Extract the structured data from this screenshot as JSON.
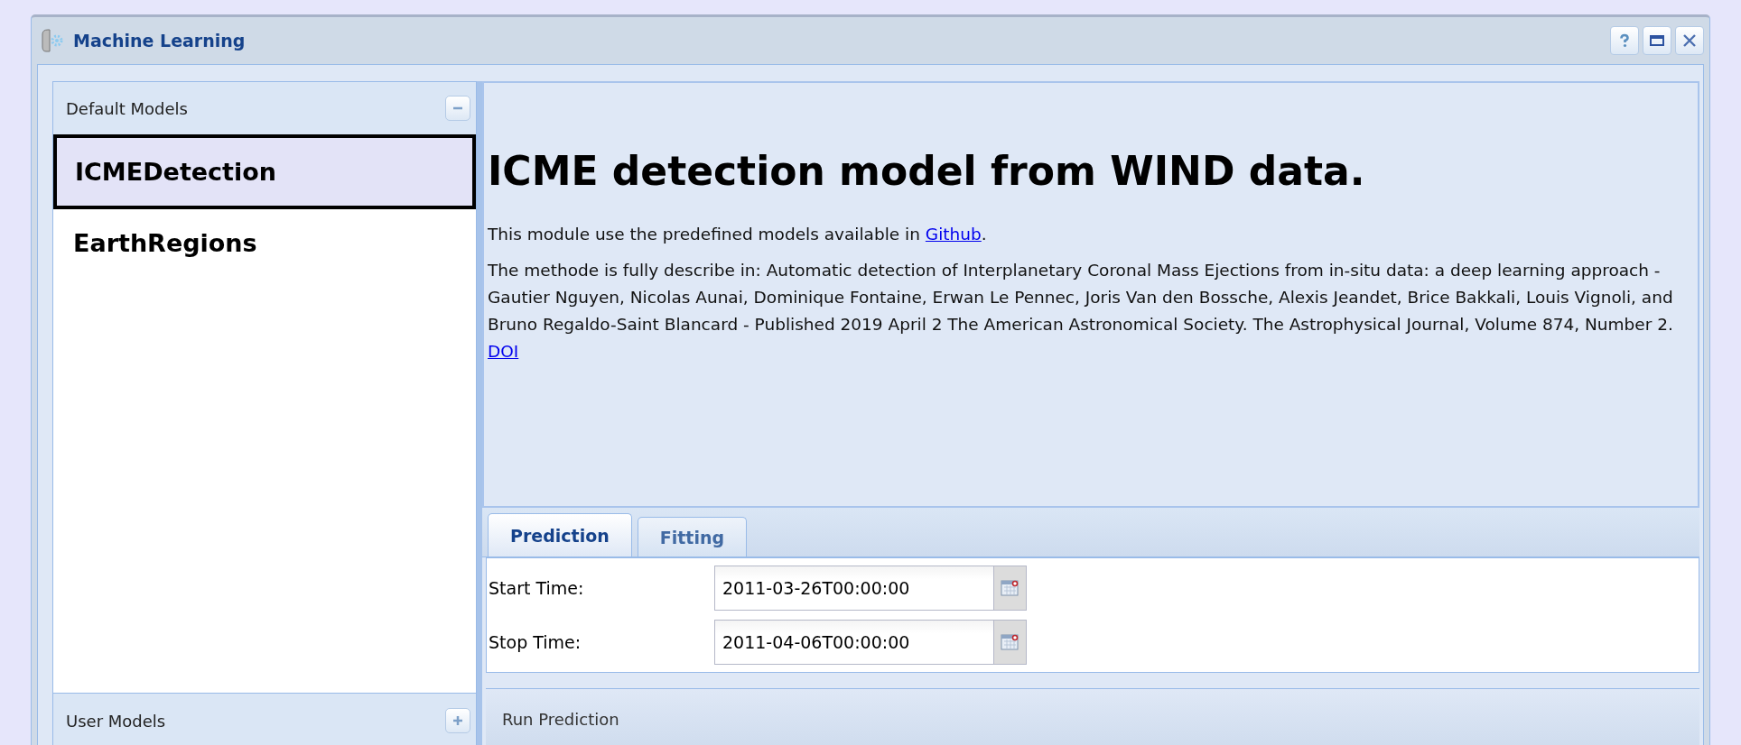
{
  "window": {
    "title": "Machine Learning",
    "tools": [
      {
        "kind": "help"
      },
      {
        "kind": "maximize"
      },
      {
        "kind": "close"
      }
    ]
  },
  "sidebar": {
    "sections": [
      {
        "title": "Default Models",
        "expanded": true,
        "items": [
          {
            "label": "ICMEDetection",
            "selected": true
          },
          {
            "label": "EarthRegions",
            "selected": false
          }
        ]
      },
      {
        "title": "User Models",
        "expanded": false
      }
    ]
  },
  "content": {
    "heading": "ICME detection model from WIND data.",
    "paragraphs": [
      {
        "text": "This module use the predefined models available in ",
        "link": "Github",
        "after": "."
      },
      {
        "text": "The methode is fully describe in: Automatic detection of Interplanetary Coronal Mass Ejections from in-situ data: a deep learning approach - Gautier Nguyen, Nicolas Aunai, Dominique Fontaine, Erwan Le Pennec, Joris Van den Bossche, Alexis Jeandet, Brice Bakkali, Louis Vignoli, and Bruno Regaldo-Saint Blancard - Published 2019 April 2 The American Astronomical Society. The Astrophysical Journal, Volume 874, Number 2. ",
        "link": "DOI"
      }
    ]
  },
  "tabs": [
    {
      "label": "Prediction",
      "selected": true
    },
    {
      "label": "Fitting",
      "selected": false
    }
  ],
  "form": {
    "fields": [
      {
        "label": "Start Time:",
        "value": "2011-03-26T00:00:00"
      },
      {
        "label": "Stop Time:",
        "value": "2011-04-06T00:00:00"
      }
    ]
  },
  "run_button": {
    "label": "Run Prediction"
  }
}
